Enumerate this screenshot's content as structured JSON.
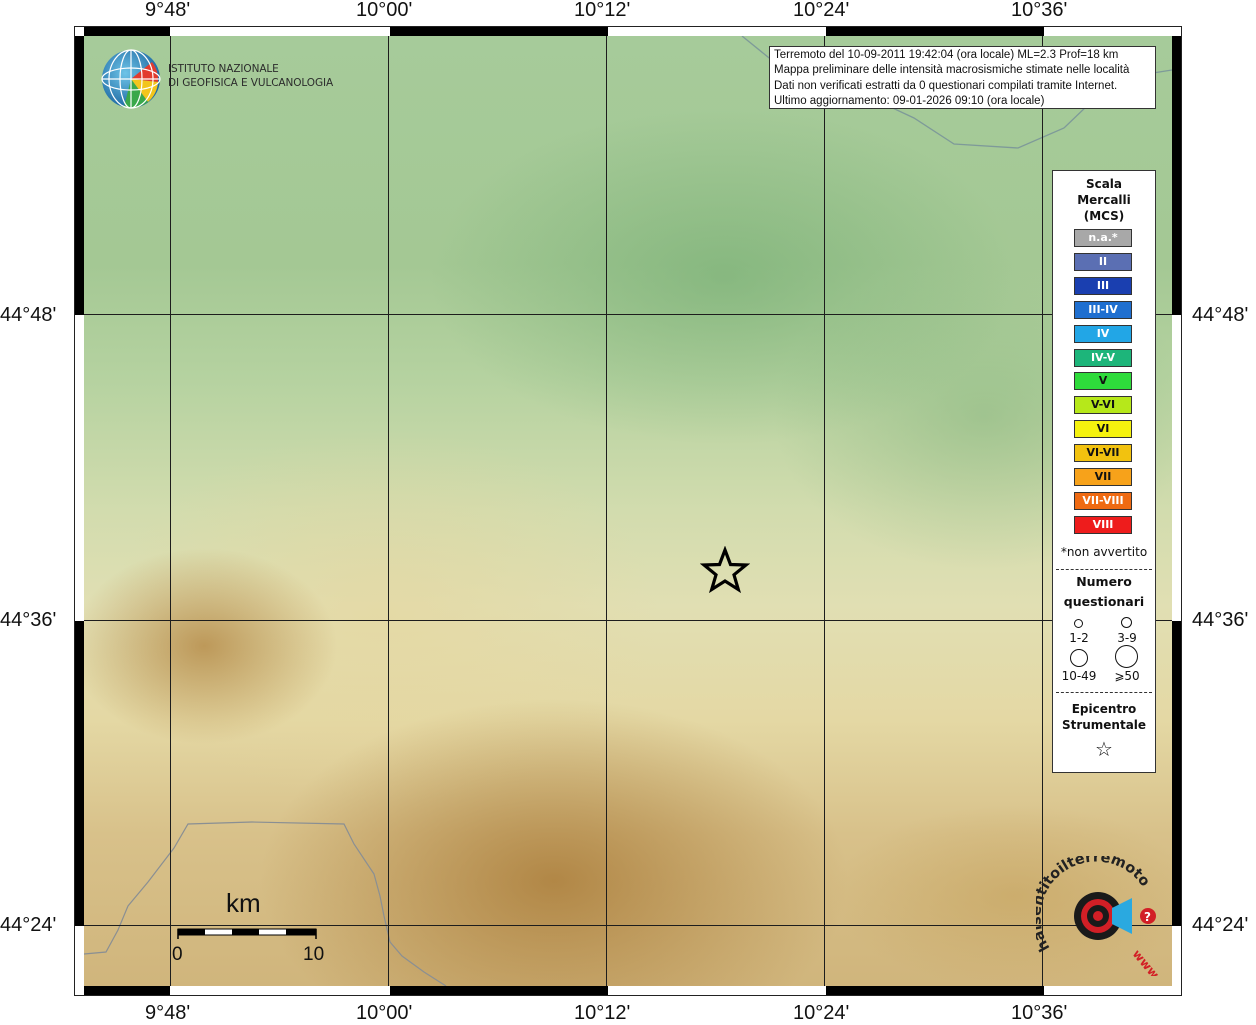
{
  "coordinates": {
    "longitudes": [
      "9°48'",
      "10°00'",
      "10°12'",
      "10°24'",
      "10°36'"
    ],
    "latitudes": [
      "44°48'",
      "44°36'",
      "44°24'"
    ]
  },
  "logo": {
    "line1": "ISTITUTO NAZIONALE",
    "line2": "DI GEOFISICA E VULCANOLOGIA"
  },
  "info": {
    "line1": "Terremoto del 10-09-2011 19:42:04 (ora locale) ML=2.3 Prof=18 km",
    "line2": "Mappa preliminare delle intensità macrosismiche stimate nelle località",
    "line3": "Dati non verificati estratti da 0 questionari compilati tramite Internet.",
    "line4": "Ultimo aggiornamento: 09-01-2026 09:10 (ora locale)"
  },
  "legend": {
    "title_lines": [
      "Scala",
      "Mercalli",
      "(MCS)"
    ],
    "intensities": [
      {
        "label": "n.a.*",
        "color": "#a8a8a8"
      },
      {
        "label": "II",
        "color": "#5b6fb3"
      },
      {
        "label": "III",
        "color": "#1a3fb0"
      },
      {
        "label": "III-IV",
        "color": "#1f6fd0"
      },
      {
        "label": "IV",
        "color": "#22a6e6"
      },
      {
        "label": "IV-V",
        "color": "#1db57a"
      },
      {
        "label": "V",
        "color": "#2edb3b"
      },
      {
        "label": "V-VI",
        "color": "#b6e81a"
      },
      {
        "label": "VI",
        "color": "#f5f20e"
      },
      {
        "label": "VI-VII",
        "color": "#f2c20f"
      },
      {
        "label": "VII",
        "color": "#f7a21a"
      },
      {
        "label": "VII-VIII",
        "color": "#ef6a12"
      },
      {
        "label": "VIII",
        "color": "#ee1c1c"
      }
    ],
    "na_note": "*non avvertito",
    "count_title_line1": "Numero",
    "count_title_line2": "questionari",
    "counts": [
      "1-2",
      "3-9",
      "10-49",
      "⩾50"
    ],
    "epicenter_line1": "Epicentro",
    "epicenter_line2": "Strumentale",
    "epicenter_symbol": "☆"
  },
  "scale_bar": {
    "unit": "km",
    "min": "0",
    "max": "10"
  },
  "hsi_logo": {
    "text": "haisentitoilterremoto.it",
    "url_text": "www."
  }
}
